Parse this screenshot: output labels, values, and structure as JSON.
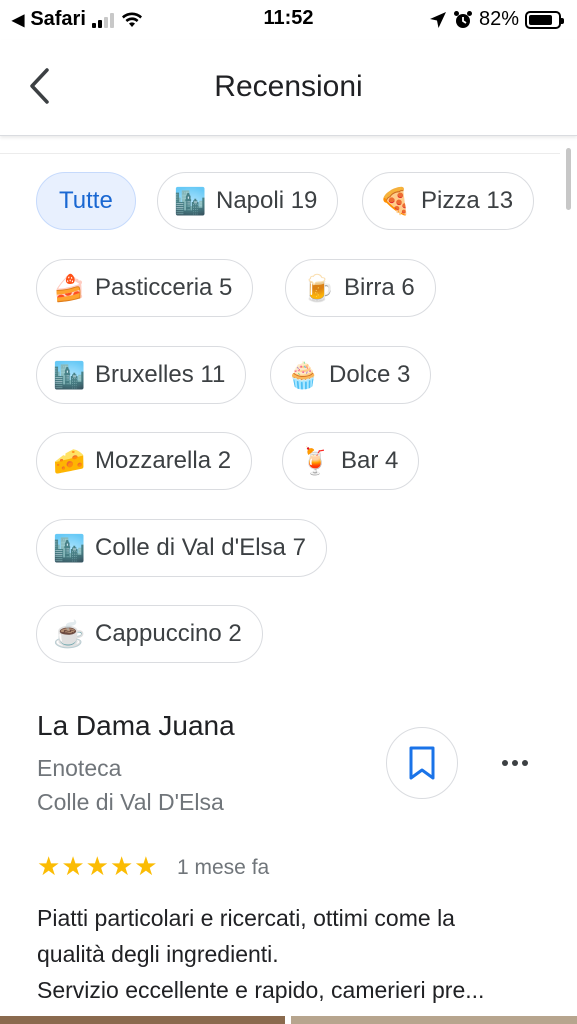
{
  "status_bar": {
    "carrier": "Safari",
    "time": "11:52",
    "battery": "82%",
    "battery_level": 0.82,
    "signal_bars": 2
  },
  "header": {
    "title": "Recensioni",
    "back_icon": "chevron-left-icon"
  },
  "filters": [
    {
      "label": "Tutte",
      "emoji": "",
      "selected": true
    },
    {
      "label": "Napoli 19",
      "emoji": "🏙️"
    },
    {
      "label": "Pizza 13",
      "emoji": "🍕"
    },
    {
      "label": "Pasticceria 5",
      "emoji": "🍰"
    },
    {
      "label": "Birra 6",
      "emoji": "🍺"
    },
    {
      "label": "Bruxelles 11",
      "emoji": "🏙️"
    },
    {
      "label": "Dolce 3",
      "emoji": "🧁"
    },
    {
      "label": "Mozzarella 2",
      "emoji": "🧀"
    },
    {
      "label": "Bar 4",
      "emoji": "🍹"
    },
    {
      "label": "Colle di Val d'Elsa 7",
      "emoji": "🏙️"
    },
    {
      "label": "Cappuccino 2",
      "emoji": "☕"
    }
  ],
  "review": {
    "place_name": "La Dama Juana",
    "category": "Enoteca",
    "city": "Colle di Val D'Elsa",
    "rating": 5,
    "date": "1 mese fa",
    "text_lines": [
      "Piatti particolari e ricercati, ottimi come la",
      "qualità degli ingredienti.",
      "Servizio eccellente e rapido, camerieri pre..."
    ]
  },
  "colors": {
    "accent": "#1a73e8",
    "selected_chip_bg": "#e8f0fe",
    "star": "#fbbc04"
  }
}
